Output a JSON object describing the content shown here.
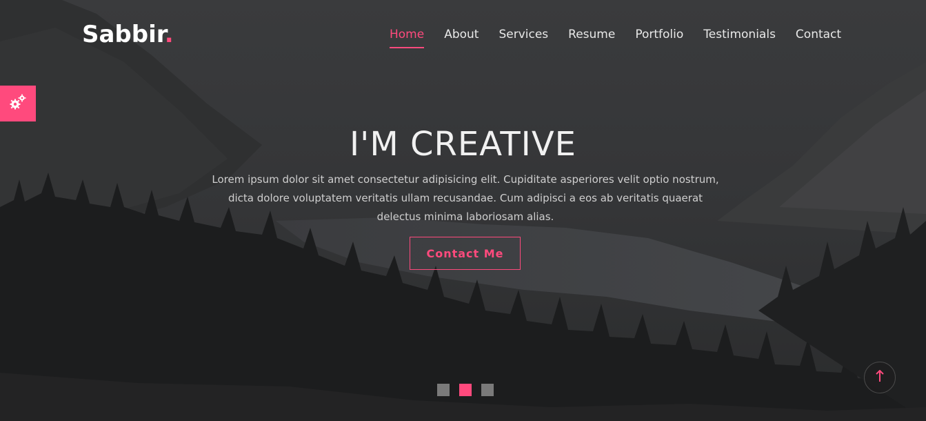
{
  "brand": {
    "name": "Sabbir",
    "dot": ".",
    "accent_color": "#ff4a7d"
  },
  "nav": {
    "items": [
      {
        "label": "Home",
        "active": true
      },
      {
        "label": "About",
        "active": false
      },
      {
        "label": "Services",
        "active": false
      },
      {
        "label": "Resume",
        "active": false
      },
      {
        "label": "Portfolio",
        "active": false
      },
      {
        "label": "Testimonials",
        "active": false
      },
      {
        "label": "Contact",
        "active": false
      }
    ]
  },
  "settings": {
    "icon": "gears-icon"
  },
  "hero": {
    "title": "I'M CREATIVE",
    "text": "Lorem ipsum dolor sit amet consectetur adipisicing elit. Cupiditate asperiores velit optio nostrum, dicta dolore voluptatem veritatis ullam recusandae. Cum adipisci a eos ab veritatis quaerat delectus minima laboriosam alias.",
    "cta_label": "Contact Me"
  },
  "slider": {
    "slides": 3,
    "active_index": 1
  },
  "back_to_top": {
    "icon": "arrow-up-icon"
  }
}
